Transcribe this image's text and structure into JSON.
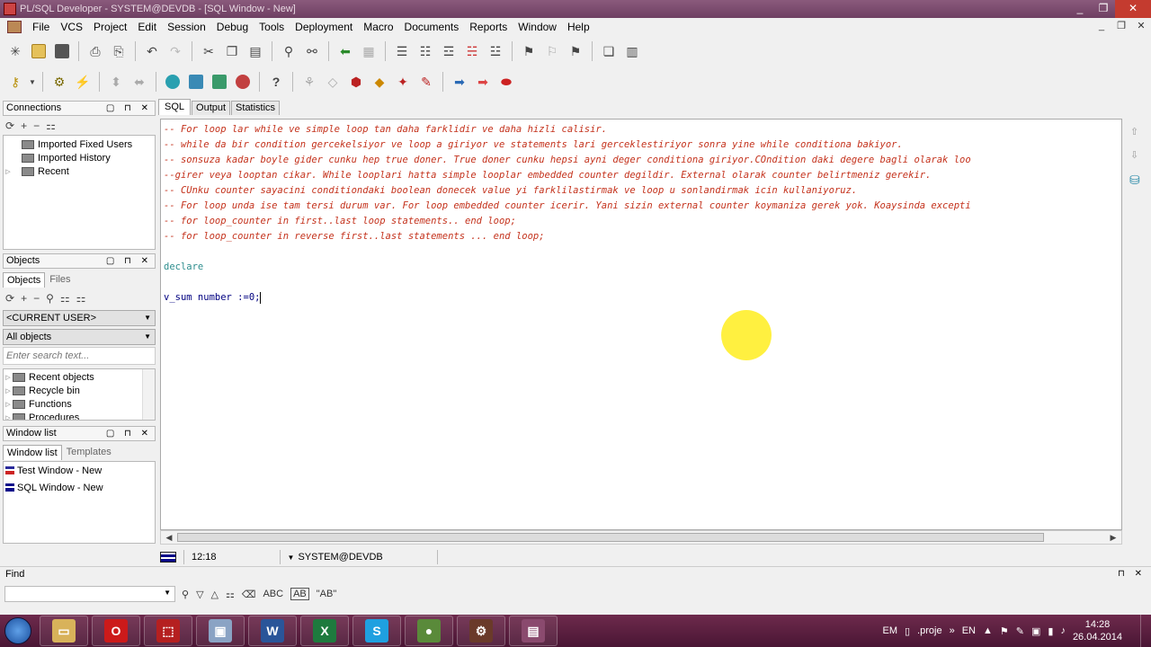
{
  "window": {
    "title": "PL/SQL Developer - SYSTEM@DEVDB - [SQL Window - New]",
    "controls": [
      "_",
      "❐",
      "✕"
    ]
  },
  "menu": {
    "items": [
      "File",
      "VCS",
      "Project",
      "Edit",
      "Session",
      "Debug",
      "Tools",
      "Deployment",
      "Macro",
      "Documents",
      "Reports",
      "Window",
      "Help"
    ],
    "mdi_controls": [
      "_",
      "❐",
      "✕"
    ]
  },
  "connections": {
    "header": "Connections",
    "items": [
      "Imported Fixed Users",
      "Imported History",
      "Recent"
    ]
  },
  "objects": {
    "header": "Objects",
    "tabs": [
      "Objects",
      "Files"
    ],
    "user_combo": "<CURRENT USER>",
    "filter_combo": "All objects",
    "search_placeholder": "Enter search text...",
    "tree": [
      "Recent objects",
      "Recycle bin",
      "Functions",
      "Procedures"
    ]
  },
  "window_list": {
    "header": "Window list",
    "tabs": [
      "Window list",
      "Templates"
    ],
    "items": [
      "Test Window - New",
      "SQL Window - New"
    ]
  },
  "editor": {
    "tabs": [
      "SQL",
      "Output",
      "Statistics"
    ],
    "lines": [
      {
        "type": "comment",
        "text": "-- For loop lar while ve simple loop tan daha farklidir ve daha hizli calisir."
      },
      {
        "type": "comment",
        "text": "-- while da bir condition gercekelsiyor ve loop a giriyor ve statements lari gerceklestiriyor sonra yine while conditiona bakiyor."
      },
      {
        "type": "comment",
        "text": "-- sonsuza kadar boyle gider cunku hep true doner. True doner cunku hepsi ayni deger conditiona giriyor.COndition daki degere bagli olarak loo"
      },
      {
        "type": "comment",
        "text": "--girer veya looptan cikar. While looplari hatta simple looplar embedded counter degildir. External olarak counter belirtmeniz gerekir."
      },
      {
        "type": "comment",
        "text": "-- CUnku counter sayacini conditiondaki boolean donecek value yi farklilastirmak ve loop u sonlandirmak icin kullaniyoruz."
      },
      {
        "type": "comment",
        "text": "-- For loop unda ise tam tersi durum var. For loop embedded counter icerir. Yani sizin external counter koymaniza gerek yok. Koaysinda excepti"
      },
      {
        "type": "comment",
        "text": "-- for loop_counter in first..last loop statements.. end loop;"
      },
      {
        "type": "comment",
        "text": "-- for loop_counter in reverse first..last statements ... end loop;"
      },
      {
        "type": "blank",
        "text": ""
      },
      {
        "type": "keyword",
        "text": "declare"
      },
      {
        "type": "blank",
        "text": ""
      },
      {
        "type": "plain",
        "text": "v_sum number :=0;"
      }
    ]
  },
  "status": {
    "position": "12:18",
    "connection": "SYSTEM@DEVDB"
  },
  "find": {
    "label": "Find",
    "value": "",
    "tools": [
      "ABC",
      "AB"
    ]
  },
  "taskbar": {
    "apps": [
      {
        "name": "explorer-icon",
        "color": "#d8b25a",
        "glyph": "▭"
      },
      {
        "name": "opera-icon",
        "color": "#cc1a1a",
        "glyph": "O"
      },
      {
        "name": "pdf-icon",
        "color": "#b52020",
        "glyph": "⬚"
      },
      {
        "name": "virtualbox-icon",
        "color": "#8aa3c4",
        "glyph": "▣"
      },
      {
        "name": "word-icon",
        "color": "#2a5599",
        "glyph": "W"
      },
      {
        "name": "excel-icon",
        "color": "#1e7a3e",
        "glyph": "X"
      },
      {
        "name": "skype-icon",
        "color": "#1fa0e0",
        "glyph": "S"
      },
      {
        "name": "toad-icon",
        "color": "#5a8a3a",
        "glyph": "●"
      },
      {
        "name": "plsql-dev-icon",
        "color": "#6a3a2a",
        "glyph": "⚙"
      },
      {
        "name": "plsql-window-icon",
        "color": "#8a4a6e",
        "glyph": "▤"
      }
    ],
    "tray": {
      "lang1": "EM",
      "doc": ".proje",
      "lang2": "EN",
      "time": "14:28",
      "date": "26.04.2014"
    }
  }
}
